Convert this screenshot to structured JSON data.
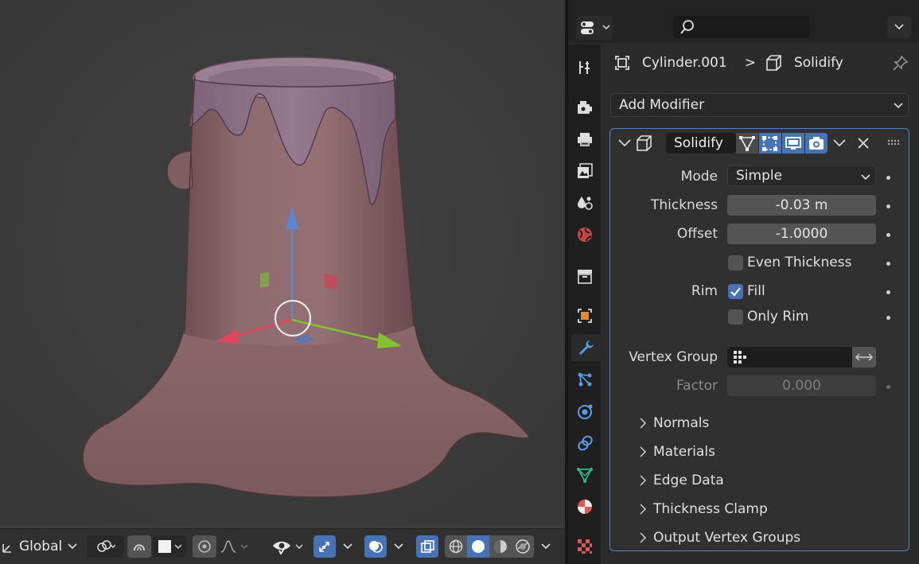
{
  "viewport": {
    "orientation_label": "Global",
    "header_icons": [
      "transform-orientation-icon",
      "pivot-icon",
      "snap-icon",
      "snap-target-icon",
      "proportional-edit-icon",
      "falloff-icon",
      "visibility-icon",
      "gizmo-icon",
      "overlays-icon",
      "xray-icon",
      "wireframe-icon",
      "solid-icon",
      "material-preview-icon",
      "rendered-icon"
    ],
    "colors": {
      "background": "#3c3c3c",
      "mesh": "#8f6a6e",
      "drip": "#8e6f86",
      "accent": "#4772b3"
    }
  },
  "properties": {
    "search": {
      "value": "",
      "placeholder": ""
    },
    "tabs": [
      "tool",
      "render",
      "output",
      "view-layer",
      "scene",
      "world",
      "collection",
      "object",
      "modifiers",
      "particles",
      "physics",
      "constraints",
      "data",
      "material"
    ],
    "active_tab": "modifiers",
    "breadcrumb": {
      "object": "Cylinder.001",
      "separator": ">",
      "modifier": "Solidify"
    },
    "add_modifier": "Add Modifier",
    "modifier": {
      "name": "Solidify",
      "rows": {
        "mode": {
          "label": "Mode",
          "value": "Simple"
        },
        "thickness": {
          "label": "Thickness",
          "value": "-0.03 m"
        },
        "offset": {
          "label": "Offset",
          "value": "-1.0000"
        },
        "even_thickness": {
          "label": "Even Thickness",
          "checked": false
        },
        "rim": {
          "label": "Rim"
        },
        "fill": {
          "label": "Fill",
          "checked": true
        },
        "only_rim": {
          "label": "Only Rim",
          "checked": false
        },
        "vertex_group": {
          "label": "Vertex Group",
          "value": ""
        },
        "factor": {
          "label": "Factor",
          "value": "0.000"
        }
      },
      "subpanels": [
        "Normals",
        "Materials",
        "Edge Data",
        "Thickness Clamp",
        "Output Vertex Groups"
      ]
    }
  }
}
